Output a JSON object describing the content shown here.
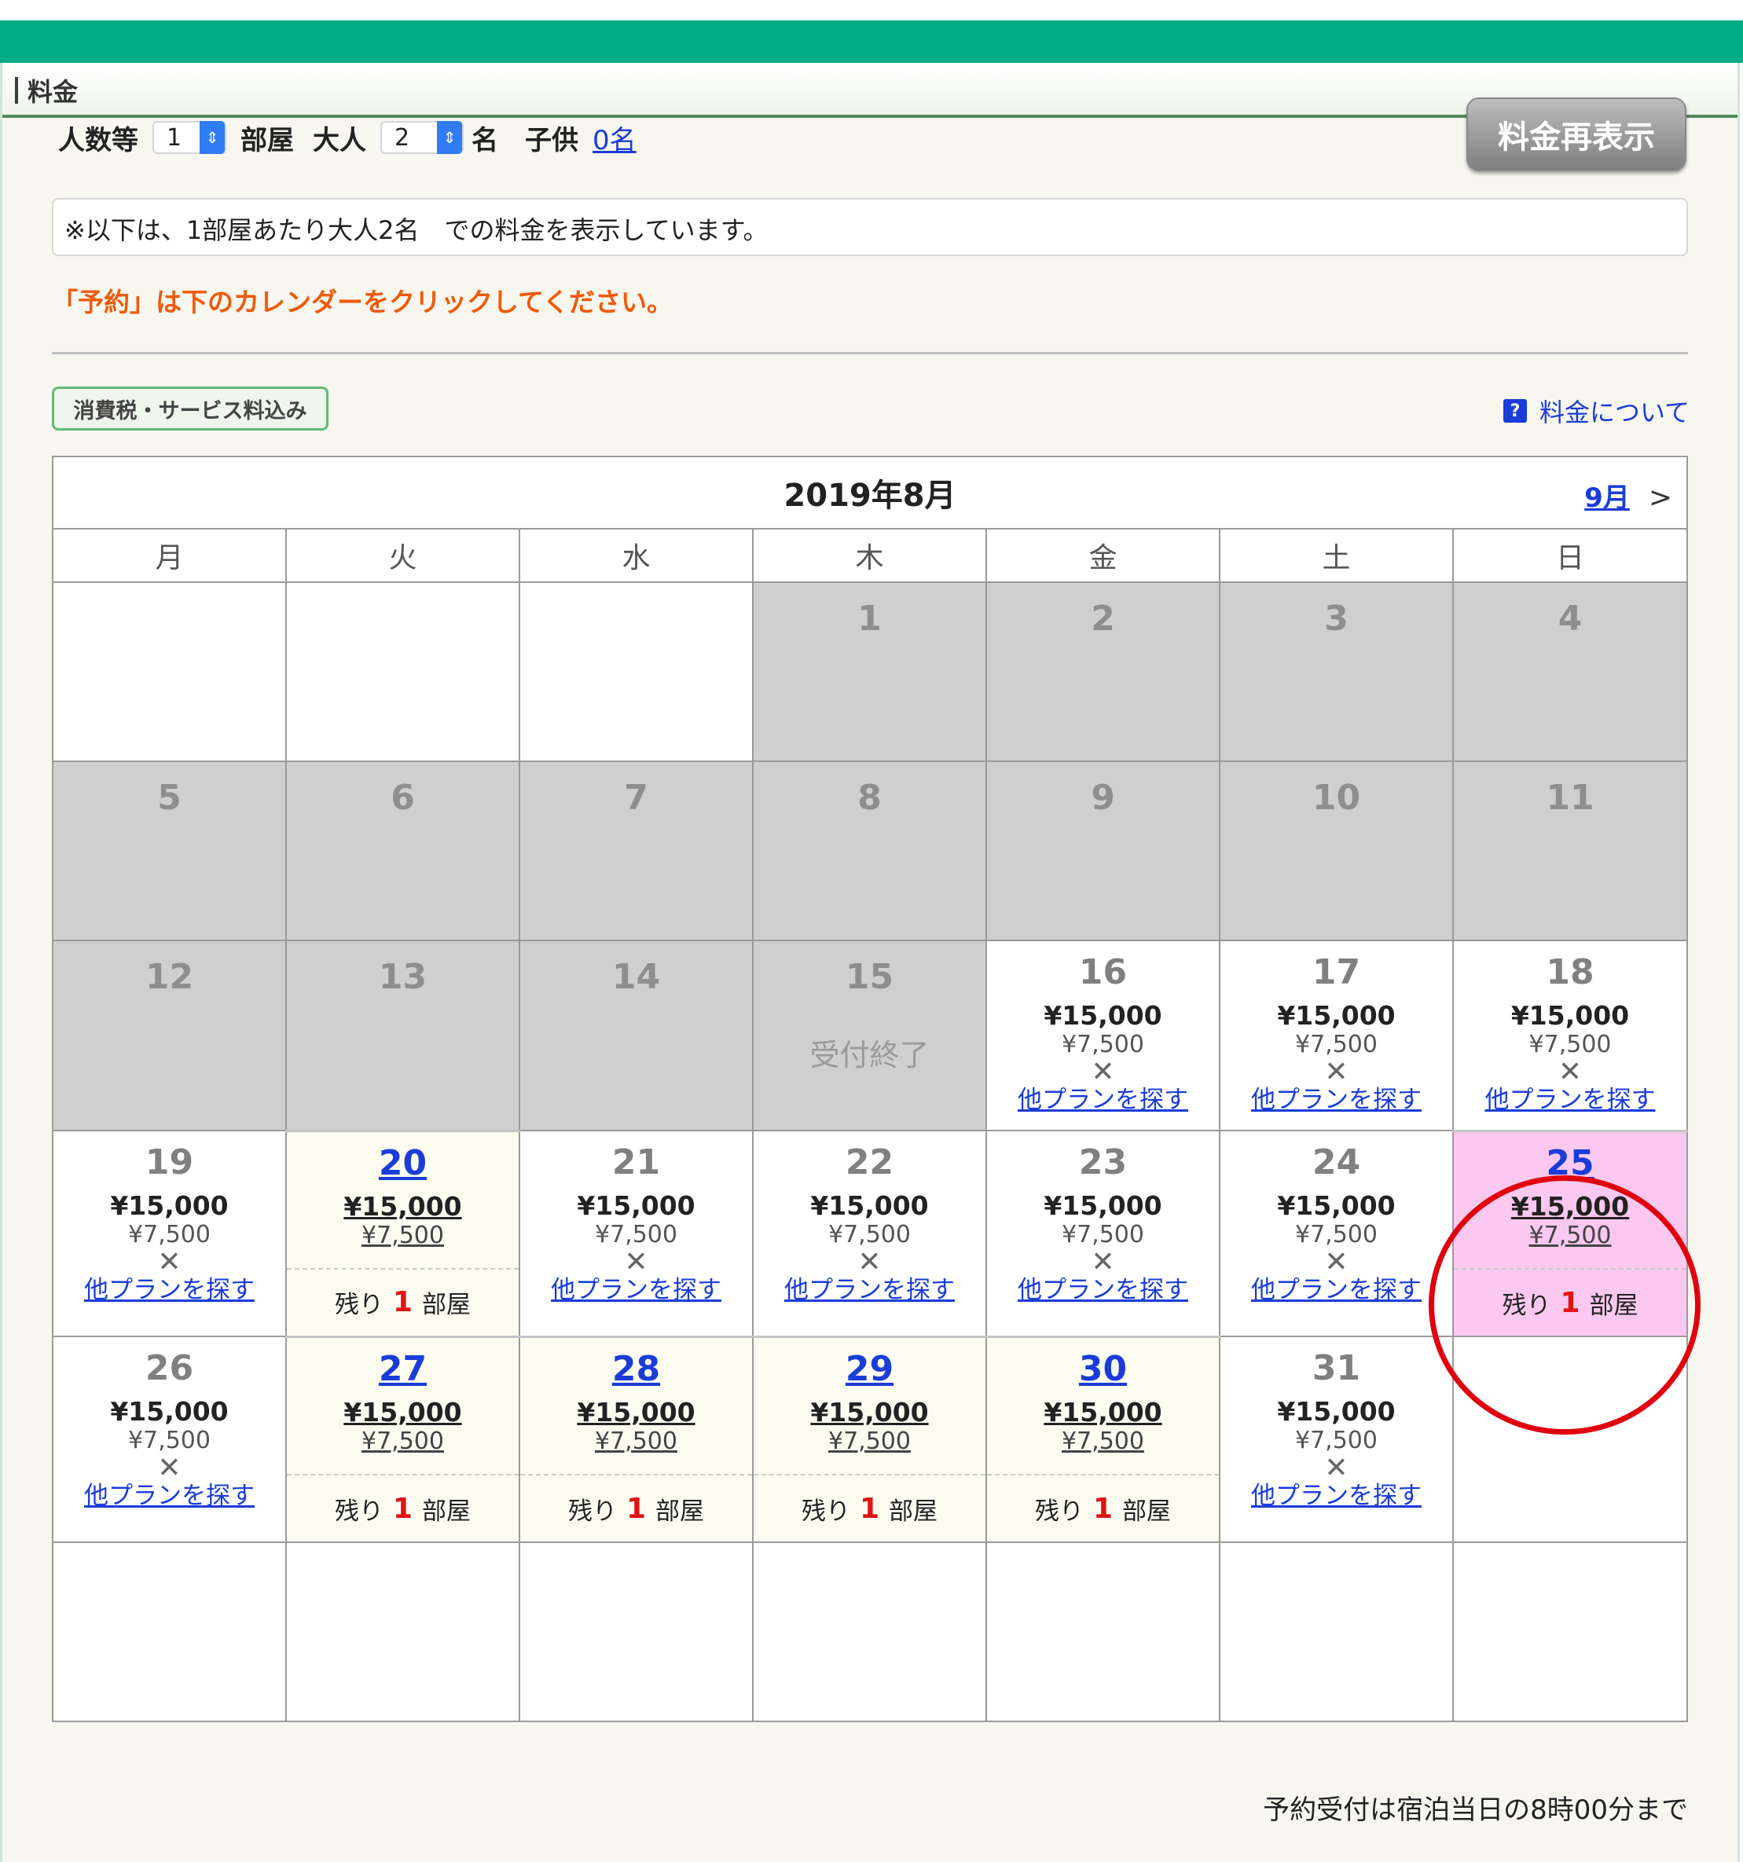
{
  "section": {
    "title": "料金"
  },
  "controls": {
    "people_label": "人数等",
    "rooms_value": "1",
    "rooms_unit": "部屋",
    "adults_label": "大人",
    "adults_value": "2",
    "adults_unit": "名",
    "children_label": "子供",
    "children_link": "0名",
    "redisplay_button": "料金再表示"
  },
  "notice": "※以下は、1部屋あたり大人2名　での料金を表示しています。",
  "instruction": "「予約」は下のカレンダーをクリックしてください。",
  "tax_badge": "消費税・サービス料込み",
  "price_info_icon": "?",
  "price_info_link": "料金について",
  "calendar": {
    "month_title": "2019年8月",
    "next_month": "9月",
    "weekdays": [
      "月",
      "火",
      "水",
      "木",
      "金",
      "土",
      "日"
    ],
    "closed_label": "受付終了",
    "other_plan_label": "他プランを探す",
    "remaining_prefix": "残り",
    "remaining_suffix": "部屋",
    "weeks": [
      [
        {
          "type": "empty"
        },
        {
          "type": "empty"
        },
        {
          "type": "empty"
        },
        {
          "type": "gray",
          "day": "1"
        },
        {
          "type": "gray",
          "day": "2"
        },
        {
          "type": "gray",
          "day": "3"
        },
        {
          "type": "gray",
          "day": "4"
        }
      ],
      [
        {
          "type": "gray",
          "day": "5"
        },
        {
          "type": "gray",
          "day": "6"
        },
        {
          "type": "gray",
          "day": "7"
        },
        {
          "type": "gray",
          "day": "8"
        },
        {
          "type": "gray",
          "day": "9"
        },
        {
          "type": "gray",
          "day": "10"
        },
        {
          "type": "gray",
          "day": "11"
        }
      ],
      [
        {
          "type": "gray",
          "day": "12"
        },
        {
          "type": "gray",
          "day": "13"
        },
        {
          "type": "gray",
          "day": "14"
        },
        {
          "type": "gray",
          "day": "15",
          "closed": true
        },
        {
          "type": "full",
          "day": "16",
          "price": "¥15,000",
          "per": "¥7,500"
        },
        {
          "type": "full",
          "day": "17",
          "price": "¥15,000",
          "per": "¥7,500"
        },
        {
          "type": "full",
          "day": "18",
          "price": "¥15,000",
          "per": "¥7,500"
        }
      ],
      [
        {
          "type": "full",
          "day": "19",
          "price": "¥15,000",
          "per": "¥7,500"
        },
        {
          "type": "avail",
          "day": "20",
          "price": "¥15,000",
          "per": "¥7,500",
          "remaining": "1"
        },
        {
          "type": "full",
          "day": "21",
          "price": "¥15,000",
          "per": "¥7,500"
        },
        {
          "type": "full",
          "day": "22",
          "price": "¥15,000",
          "per": "¥7,500"
        },
        {
          "type": "full",
          "day": "23",
          "price": "¥15,000",
          "per": "¥7,500"
        },
        {
          "type": "full",
          "day": "24",
          "price": "¥15,000",
          "per": "¥7,500"
        },
        {
          "type": "avail",
          "day": "25",
          "price": "¥15,000",
          "per": "¥7,500",
          "remaining": "1",
          "highlight": true
        }
      ],
      [
        {
          "type": "full",
          "day": "26",
          "price": "¥15,000",
          "per": "¥7,500"
        },
        {
          "type": "avail",
          "day": "27",
          "price": "¥15,000",
          "per": "¥7,500",
          "remaining": "1"
        },
        {
          "type": "avail",
          "day": "28",
          "price": "¥15,000",
          "per": "¥7,500",
          "remaining": "1"
        },
        {
          "type": "avail",
          "day": "29",
          "price": "¥15,000",
          "per": "¥7,500",
          "remaining": "1"
        },
        {
          "type": "avail",
          "day": "30",
          "price": "¥15,000",
          "per": "¥7,500",
          "remaining": "1"
        },
        {
          "type": "full",
          "day": "31",
          "price": "¥15,000",
          "per": "¥7,500"
        },
        {
          "type": "empty"
        }
      ],
      [
        {
          "type": "empty"
        },
        {
          "type": "empty"
        },
        {
          "type": "empty"
        },
        {
          "type": "empty"
        },
        {
          "type": "empty"
        },
        {
          "type": "empty"
        },
        {
          "type": "empty"
        }
      ]
    ]
  },
  "footer_note": "予約受付は宿泊当日の8時00分まで",
  "colors": {
    "header_green": "#00ac84",
    "accent_orange": "#f05a08",
    "link_blue": "#1a3cd8",
    "highlight_pink": "#fbc8ef",
    "annotation_red": "#e0000e"
  }
}
